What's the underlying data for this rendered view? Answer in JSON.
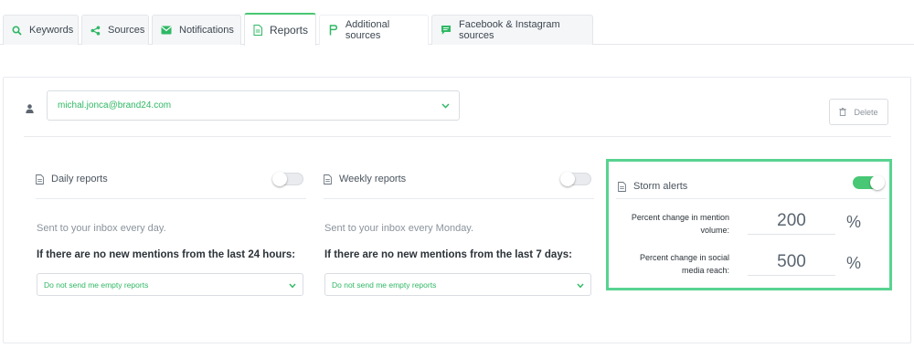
{
  "tabs": [
    {
      "label": "Keywords",
      "icon": "search-icon"
    },
    {
      "label": "Sources",
      "icon": "share-icon"
    },
    {
      "label": "Notifications",
      "icon": "envelope-icon"
    },
    {
      "label": "Reports",
      "icon": "document-icon",
      "active": true
    },
    {
      "label": "Additional sources",
      "icon": "flag-p-icon"
    },
    {
      "label": "Facebook & Instagram sources",
      "icon": "chat-icon"
    }
  ],
  "recipient": {
    "email": "michal.jonca@brand24.com"
  },
  "delete_label": "Delete",
  "daily": {
    "title": "Daily reports",
    "enabled": false,
    "description": "Sent to your inbox every day.",
    "condition": "If there are no new mentions from the last 24 hours:",
    "selected_option": "Do not send me empty reports"
  },
  "weekly": {
    "title": "Weekly reports",
    "enabled": false,
    "description": "Sent to your inbox every Monday.",
    "condition": "If there are no new mentions from the last 7 days:",
    "selected_option": "Do not send me empty reports"
  },
  "storm": {
    "title": "Storm alerts",
    "enabled": true,
    "params": [
      {
        "label_line1": "Percent change in mention",
        "label_line2": "volume:",
        "value": "200",
        "unit": "%"
      },
      {
        "label_line1": "Percent change in social",
        "label_line2": "media reach:",
        "value": "500",
        "unit": "%"
      }
    ]
  },
  "colors": {
    "accent": "#48c774",
    "highlight_border": "#58d390",
    "link_green": "#2fb864"
  }
}
